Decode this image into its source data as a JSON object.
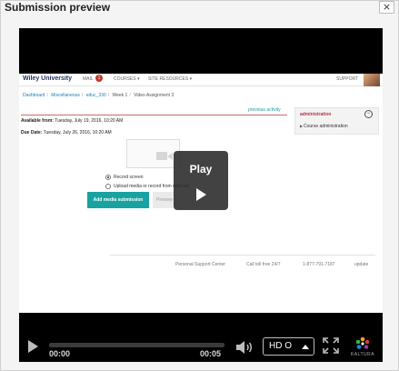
{
  "dialog": {
    "title": "Submission preview",
    "close_label": "×"
  },
  "site": {
    "brand": "Wiley University",
    "nav": {
      "mail": "MAIL",
      "mail_count": "1",
      "courses": "COURSES ▾",
      "site_resources": "SITE RESOURCES ▾",
      "support": "SUPPORT"
    },
    "breadcrumb": [
      "Dashboard",
      "Miscellaneous",
      "educ_330",
      "Week 1",
      "Video Assignment 3"
    ],
    "previous_activity": "previous activity",
    "available_label": "Available from:",
    "available_value": "Tuesday, July 19, 2016, 10:20 AM",
    "due_label": "Due Date:",
    "due_value": "Tuesday, July 26, 2016, 10:20 AM",
    "admin": {
      "title": "administration",
      "collapse": "−",
      "item": "Course administration"
    },
    "radio": {
      "option1": "Record screen",
      "option2": "Upload media or record from webcam"
    },
    "add_media": "Add media submission",
    "preview": "Preview",
    "footer": {
      "support": "Personal Support Center",
      "toll_free": "Call toll free 24/7",
      "phone": "1-877-791-7187",
      "update": "update"
    }
  },
  "player": {
    "overlay_label": "Play",
    "current_time": "00:00",
    "duration": "00:05",
    "quality": "HD O",
    "brand": "KALTURA"
  }
}
